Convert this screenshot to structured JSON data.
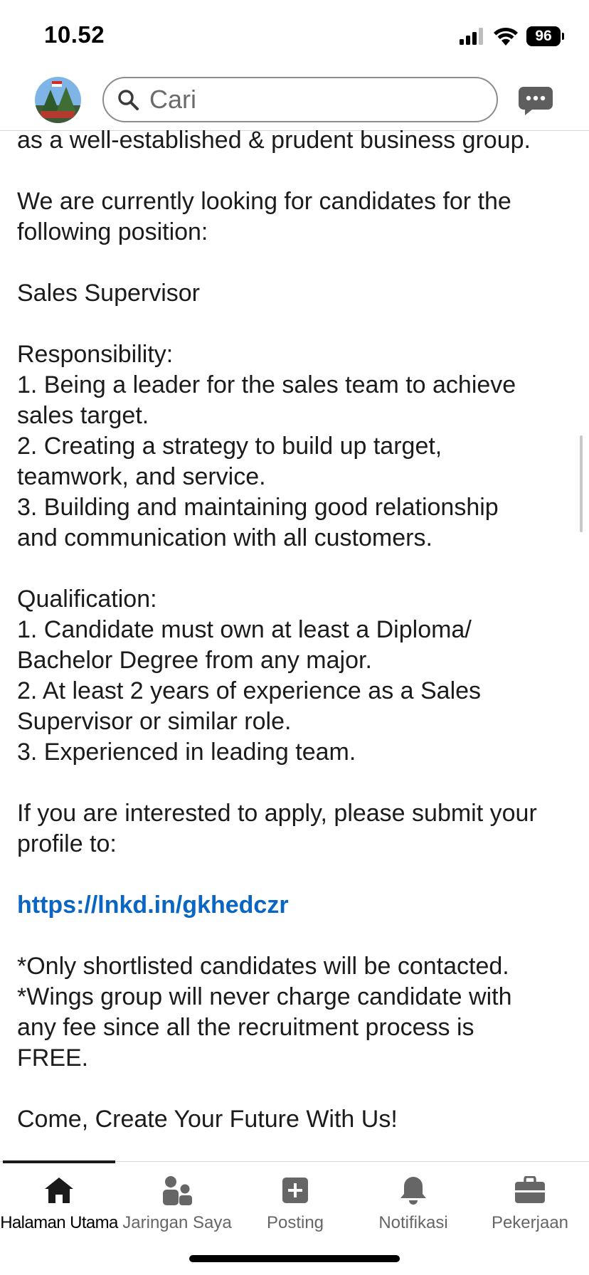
{
  "status_bar": {
    "time": "10.52",
    "battery": "96"
  },
  "header": {
    "search_placeholder": "Cari"
  },
  "post": {
    "lines": [
      "as a well-established & prudent business group.",
      "",
      "We are currently looking for candidates for the",
      "following position:",
      "",
      "Sales Supervisor",
      "",
      "Responsibility:",
      "1. Being a leader for the sales team to achieve",
      "sales target.",
      "2. Creating a strategy to build up target,",
      "teamwork, and service.",
      "3. Building and maintaining good relationship",
      "and communication with all customers.",
      "",
      "Qualification:",
      "1. Candidate must own at least a Diploma/",
      "Bachelor Degree from any major.",
      "2. At least 2 years of experience as a Sales",
      "Supervisor or similar role.",
      "3. Experienced in leading team.",
      "",
      "If you are interested to apply, please submit your",
      "profile to:",
      ""
    ],
    "link": "https://lnkd.in/gkhedczr",
    "after_lines": [
      "",
      "*Only shortlisted candidates will be contacted.",
      "*Wings group will never charge candidate with",
      "any fee since all the recruitment process is",
      "FREE.",
      "",
      "Come, Create Your Future With Us!"
    ]
  },
  "bottom_nav": [
    {
      "label": "Halaman Utama",
      "icon": "home-icon",
      "active": true
    },
    {
      "label": "Jaringan Saya",
      "icon": "network-icon",
      "active": false
    },
    {
      "label": "Posting",
      "icon": "post-icon",
      "active": false
    },
    {
      "label": "Notifikasi",
      "icon": "bell-icon",
      "active": false
    },
    {
      "label": "Pekerjaan",
      "icon": "briefcase-icon",
      "active": false
    }
  ],
  "colors": {
    "link": "#0a66c2",
    "text": "#1b1b1b",
    "nav_inactive": "#666666"
  }
}
